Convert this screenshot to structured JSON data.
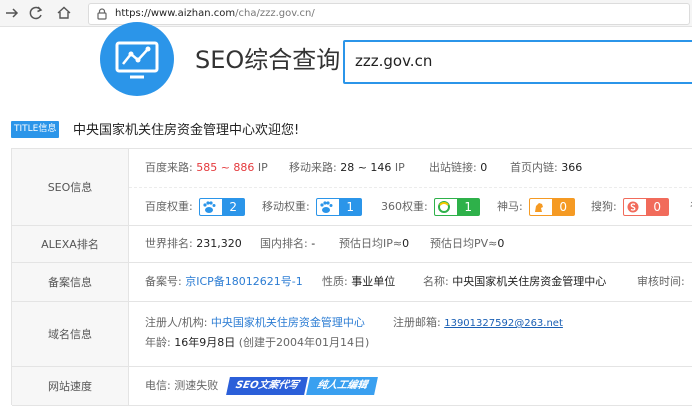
{
  "browser": {
    "url_host": "https://www.aizhan.com",
    "url_path": "/cha/zzz.gov.cn/"
  },
  "header": {
    "title": "SEO综合查询",
    "search_value": "zzz.gov.cn"
  },
  "site_title_row": {
    "badge": "TITLE信息",
    "title": "中央国家机关住房资金管理中心欢迎您!"
  },
  "seo": {
    "label": "SEO信息",
    "baidu_traffic_label": "百度来路:",
    "baidu_traffic_value": "585 ~ 886",
    "baidu_traffic_unit": "IP",
    "mobile_traffic_label": "移动来路:",
    "mobile_traffic_value": "28 ~ 146",
    "mobile_traffic_unit": "IP",
    "outbound_label": "出站链接:",
    "outbound_value": "0",
    "homepage_links_label": "首页内链:",
    "homepage_links_value": "366",
    "baidu_weight_label": "百度权重:",
    "baidu_weight_value": "2",
    "mobile_weight_label": "移动权重:",
    "mobile_weight_value": "1",
    "w360_label": "360权重:",
    "w360_value": "1",
    "shenma_label": "神马:",
    "shenma_value": "0",
    "sogou_label": "搜狗:",
    "sogou_value": "0",
    "more_label": "谷"
  },
  "alexa": {
    "label": "ALEXA排名",
    "world_label": "世界排名:",
    "world_value": "231,320",
    "domestic_label": "国内排名:",
    "domestic_value": "-",
    "daily_ip_label": "预估日均IP≈",
    "daily_ip_value": "0",
    "daily_pv_label": "预估日均PV≈",
    "daily_pv_value": "0"
  },
  "icp": {
    "label": "备案信息",
    "number_label": "备案号:",
    "number_value": "京ICP备18012621号-1",
    "nature_label": "性质:",
    "nature_value": "事业单位",
    "name_label": "名称:",
    "name_value": "中央国家机关住房资金管理中心",
    "review_label": "审核时间:"
  },
  "domain": {
    "label": "域名信息",
    "registrant_label": "注册人/机构:",
    "registrant_value": "中央国家机关住房资金管理中心",
    "email_label": "注册邮箱:",
    "email_value": "13901327592@263.net",
    "age_label": "年龄:",
    "age_value": "16年9月8日",
    "created_value": "(创建于2004年01月14日)"
  },
  "speed": {
    "label": "网站速度",
    "telecom_label": "电信:",
    "telecom_value": "测速失败",
    "ad_part1": "SEO文案代写",
    "ad_part2": "纯人工编辑"
  },
  "colors": {
    "brand_blue": "#2b95e9",
    "red": "#e4393c",
    "green": "#2eb14a",
    "orange": "#f59a23"
  }
}
